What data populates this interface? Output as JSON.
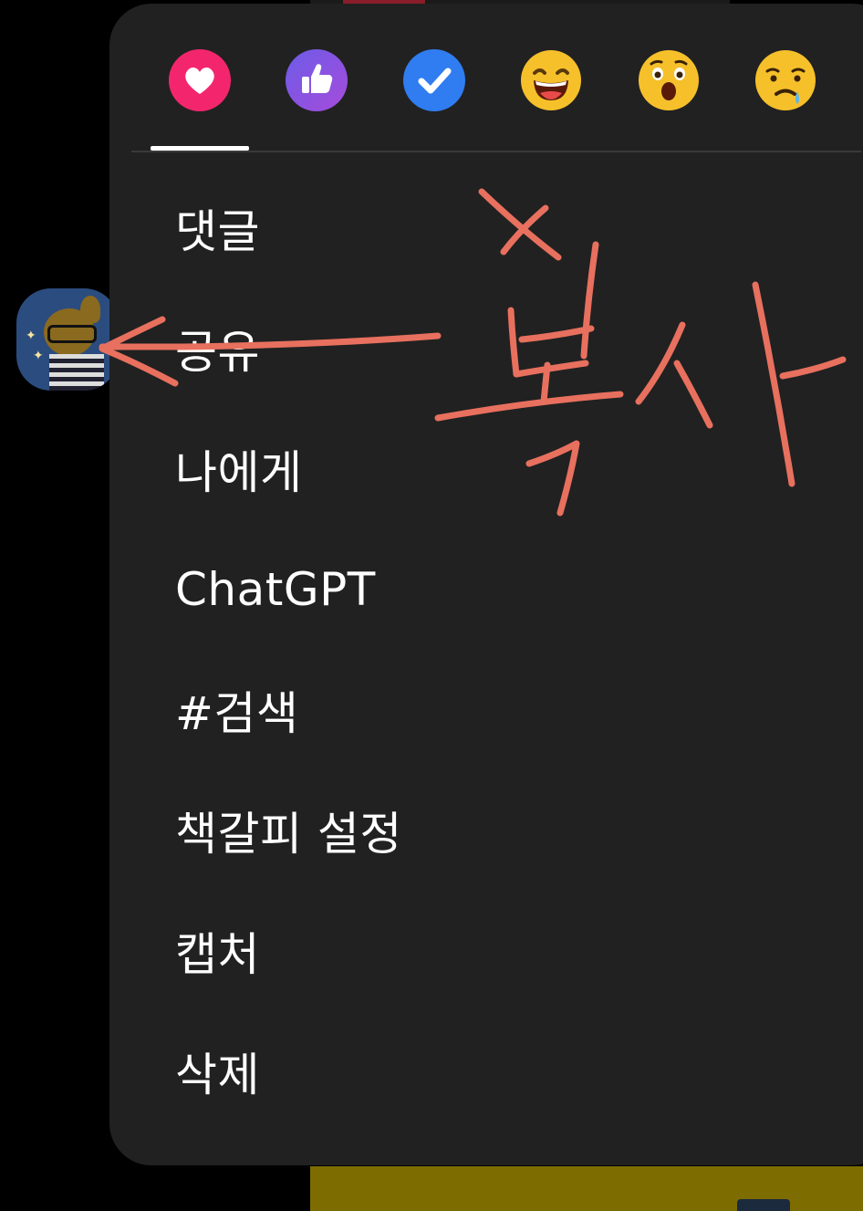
{
  "reactions": [
    {
      "name": "heart",
      "color": "#F3266D"
    },
    {
      "name": "thumbs-up",
      "color": "#8A4FE0"
    },
    {
      "name": "check",
      "color": "#2F7DF0"
    },
    {
      "name": "laughing",
      "color": "#F6C02B"
    },
    {
      "name": "surprised",
      "color": "#F6C02B"
    },
    {
      "name": "sad",
      "color": "#F6C02B"
    }
  ],
  "menu": {
    "items": [
      {
        "label": "댓글"
      },
      {
        "label": "공유"
      },
      {
        "label": "나에게"
      },
      {
        "label": "ChatGPT"
      },
      {
        "label": "#검색"
      },
      {
        "label": "책갈피 설정"
      },
      {
        "label": "캡처"
      },
      {
        "label": "삭제"
      }
    ]
  },
  "annotation": {
    "text": "복사",
    "mark": "×",
    "color": "#E8705E"
  },
  "colors": {
    "panel": "#212121",
    "background": "#000000",
    "bottom_bubble": "#7D6D00"
  }
}
